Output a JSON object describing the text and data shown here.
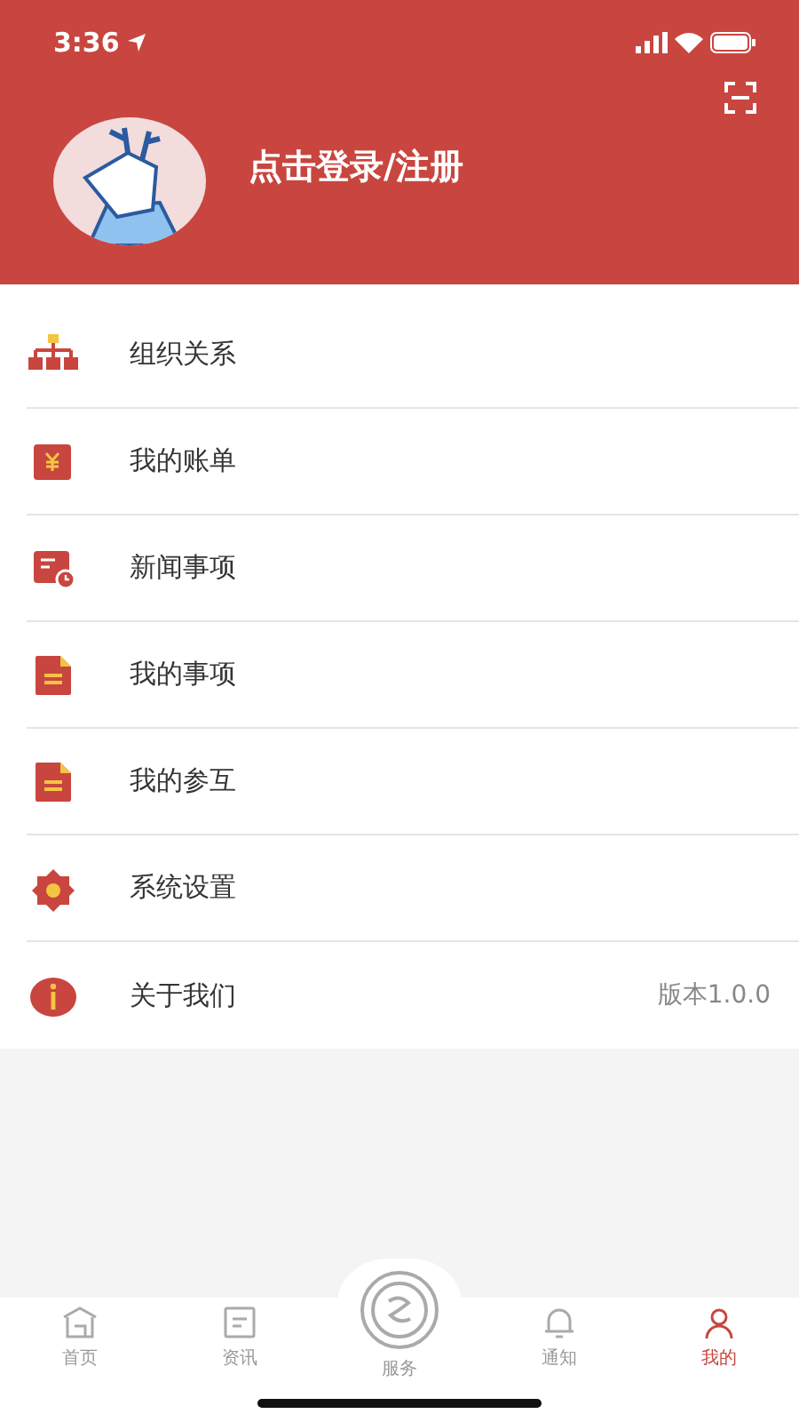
{
  "status_bar": {
    "time": "3:36"
  },
  "header": {
    "login_text": "点击登录/注册"
  },
  "menu": [
    {
      "kind": "org",
      "label": "组织关系"
    },
    {
      "kind": "bill",
      "label": "我的账单"
    },
    {
      "kind": "news",
      "label": "新闻事项"
    },
    {
      "kind": "doc",
      "label": "我的事项"
    },
    {
      "kind": "doc",
      "label": "我的参互"
    },
    {
      "kind": "gear",
      "label": "系统设置"
    },
    {
      "kind": "info",
      "label": "关于我们",
      "value": "版本1.0.0"
    }
  ],
  "tab_bar": [
    {
      "kind": "home",
      "label": "首页",
      "selected": false
    },
    {
      "kind": "news",
      "label": "资讯",
      "selected": false
    },
    {
      "kind": "service",
      "label": "服务",
      "selected": false
    },
    {
      "kind": "bell",
      "label": "通知",
      "selected": false
    },
    {
      "kind": "user",
      "label": "我的",
      "selected": true
    }
  ]
}
